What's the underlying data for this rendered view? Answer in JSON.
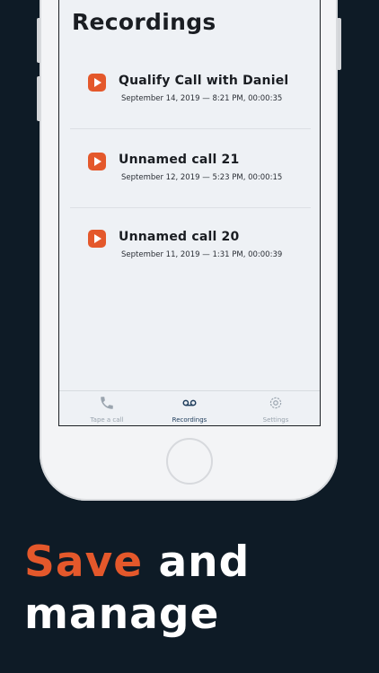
{
  "screen": {
    "title": "Recordings",
    "recordings": [
      {
        "name": "Qualify Call with Daniel",
        "meta": "September 14, 2019 — 8:21 PM, 00:00:35"
      },
      {
        "name": "Unnamed call 21",
        "meta": "September 12, 2019 — 5:23 PM, 00:00:15"
      },
      {
        "name": "Unnamed call 20",
        "meta": "September 11, 2019 — 1:31 PM, 00:00:39"
      }
    ],
    "tabbar": {
      "tabs": [
        {
          "label": "Tape a call",
          "icon": "phone-icon"
        },
        {
          "label": "Recordings",
          "icon": "voicemail-icon",
          "active": true
        },
        {
          "label": "Settings",
          "icon": "gear-icon"
        }
      ]
    }
  },
  "headline": {
    "accent": "Save",
    "rest1": "and",
    "line2": "manage"
  },
  "colors": {
    "background": "#0e1b26",
    "accent": "#e4582b",
    "active_tab": "#1f3d5c",
    "inactive_tab": "#9aa4ae"
  }
}
